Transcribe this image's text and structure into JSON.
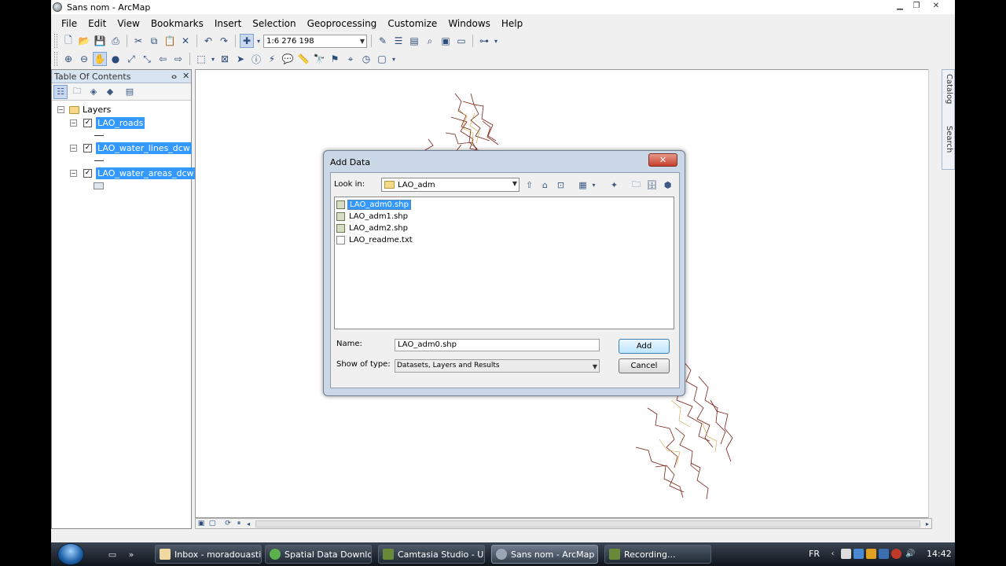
{
  "window": {
    "title": "Sans nom - ArcMap",
    "min": "▁",
    "max": "❐",
    "close": "✕"
  },
  "menu": [
    "File",
    "Edit",
    "View",
    "Bookmarks",
    "Insert",
    "Selection",
    "Geoprocessing",
    "Customize",
    "Windows",
    "Help"
  ],
  "toolbar": {
    "scale": "1:6 276 198"
  },
  "toc": {
    "title": "Table Of Contents",
    "pin": "ⴰ",
    "close": "✕",
    "root_label": "Layers",
    "layers": [
      {
        "name": "LAO_roads",
        "checked": "✓"
      },
      {
        "name": "LAO_water_lines_dcw",
        "checked": "✓"
      },
      {
        "name": "LAO_water_areas_dcw",
        "checked": "✓"
      }
    ]
  },
  "side_panel": {
    "catalog": "Catalog",
    "search": "Search"
  },
  "dialog": {
    "title": "Add Data",
    "close": "✕",
    "look_in_label": "Look in:",
    "look_in_value": "LAO_adm",
    "files": [
      "LAO_adm0.shp",
      "LAO_adm1.shp",
      "LAO_adm2.shp",
      "LAO_readme.txt"
    ],
    "selected_index": 0,
    "name_label": "Name:",
    "name_value": "LAO_adm0.shp",
    "type_label": "Show of type:",
    "type_value": "Datasets, Layers and Results",
    "add_button": "Add",
    "cancel_button": "Cancel"
  },
  "taskbar": {
    "tasks": [
      "Inbox - moradouasti...",
      "Spatial Data Downlo...",
      "Camtasia Studio - U...",
      "Sans nom - ArcMap",
      "Recording..."
    ],
    "active_task": "Sans nom - ArcMap",
    "lang": "FR",
    "time": "14:42"
  },
  "colors": {
    "selection": "#3399ff",
    "map_roads": "#7a1f12",
    "map_roads_secondary": "#c9a23b"
  }
}
